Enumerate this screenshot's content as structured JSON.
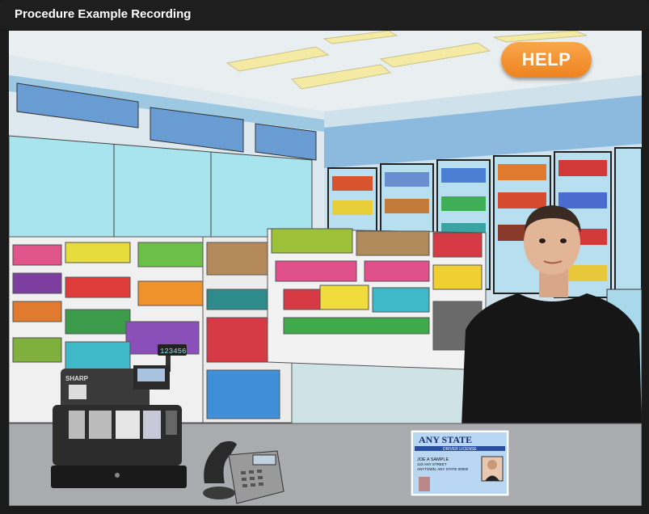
{
  "window": {
    "title": "Procedure Example Recording"
  },
  "help_button": {
    "label": "HELP"
  },
  "register": {
    "brand": "SHARP",
    "display": "123456"
  },
  "license": {
    "state": "ANY STATE",
    "type": "DRIVER LICENSE",
    "name": "JOE A SAMPLE",
    "address1": "123 ANY STREET",
    "address2": "ANYTOWN, ANY STATE 00000"
  },
  "colors": {
    "titlebar": "#1e1e1e",
    "help": "#f39233",
    "counter": "#a9abaf"
  },
  "icons": [
    "cash-register-icon",
    "desk-phone-icon",
    "drivers-license-icon"
  ]
}
